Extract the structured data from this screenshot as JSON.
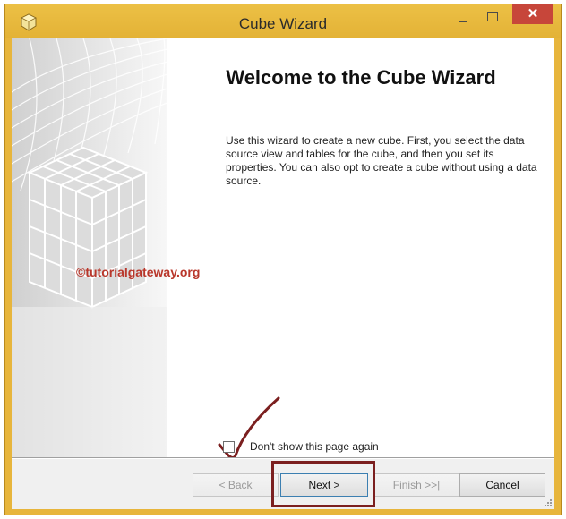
{
  "window": {
    "title": "Cube Wizard",
    "close_glyph": "✕",
    "icons": {
      "app": "cube-app-icon",
      "minimize": "minimize-icon",
      "maximize": "maximize-icon",
      "close": "close-icon"
    }
  },
  "page": {
    "heading": "Welcome to the Cube Wizard",
    "description": "Use this wizard to create a new cube. First, you select the data source view and tables for the cube, and then you set its properties. You can also opt to create a cube without using a data source.",
    "watermark": "©tutorialgateway.org"
  },
  "checkbox": {
    "label": "Don't show this page again",
    "checked": false
  },
  "buttons": {
    "back": "< Back",
    "next": "Next >",
    "finish": "Finish >>|",
    "cancel": "Cancel"
  },
  "colors": {
    "title_bar": "#e7b53c",
    "close_button": "#c7463a",
    "annotation": "#7b1f1f",
    "watermark": "#b9372b"
  }
}
